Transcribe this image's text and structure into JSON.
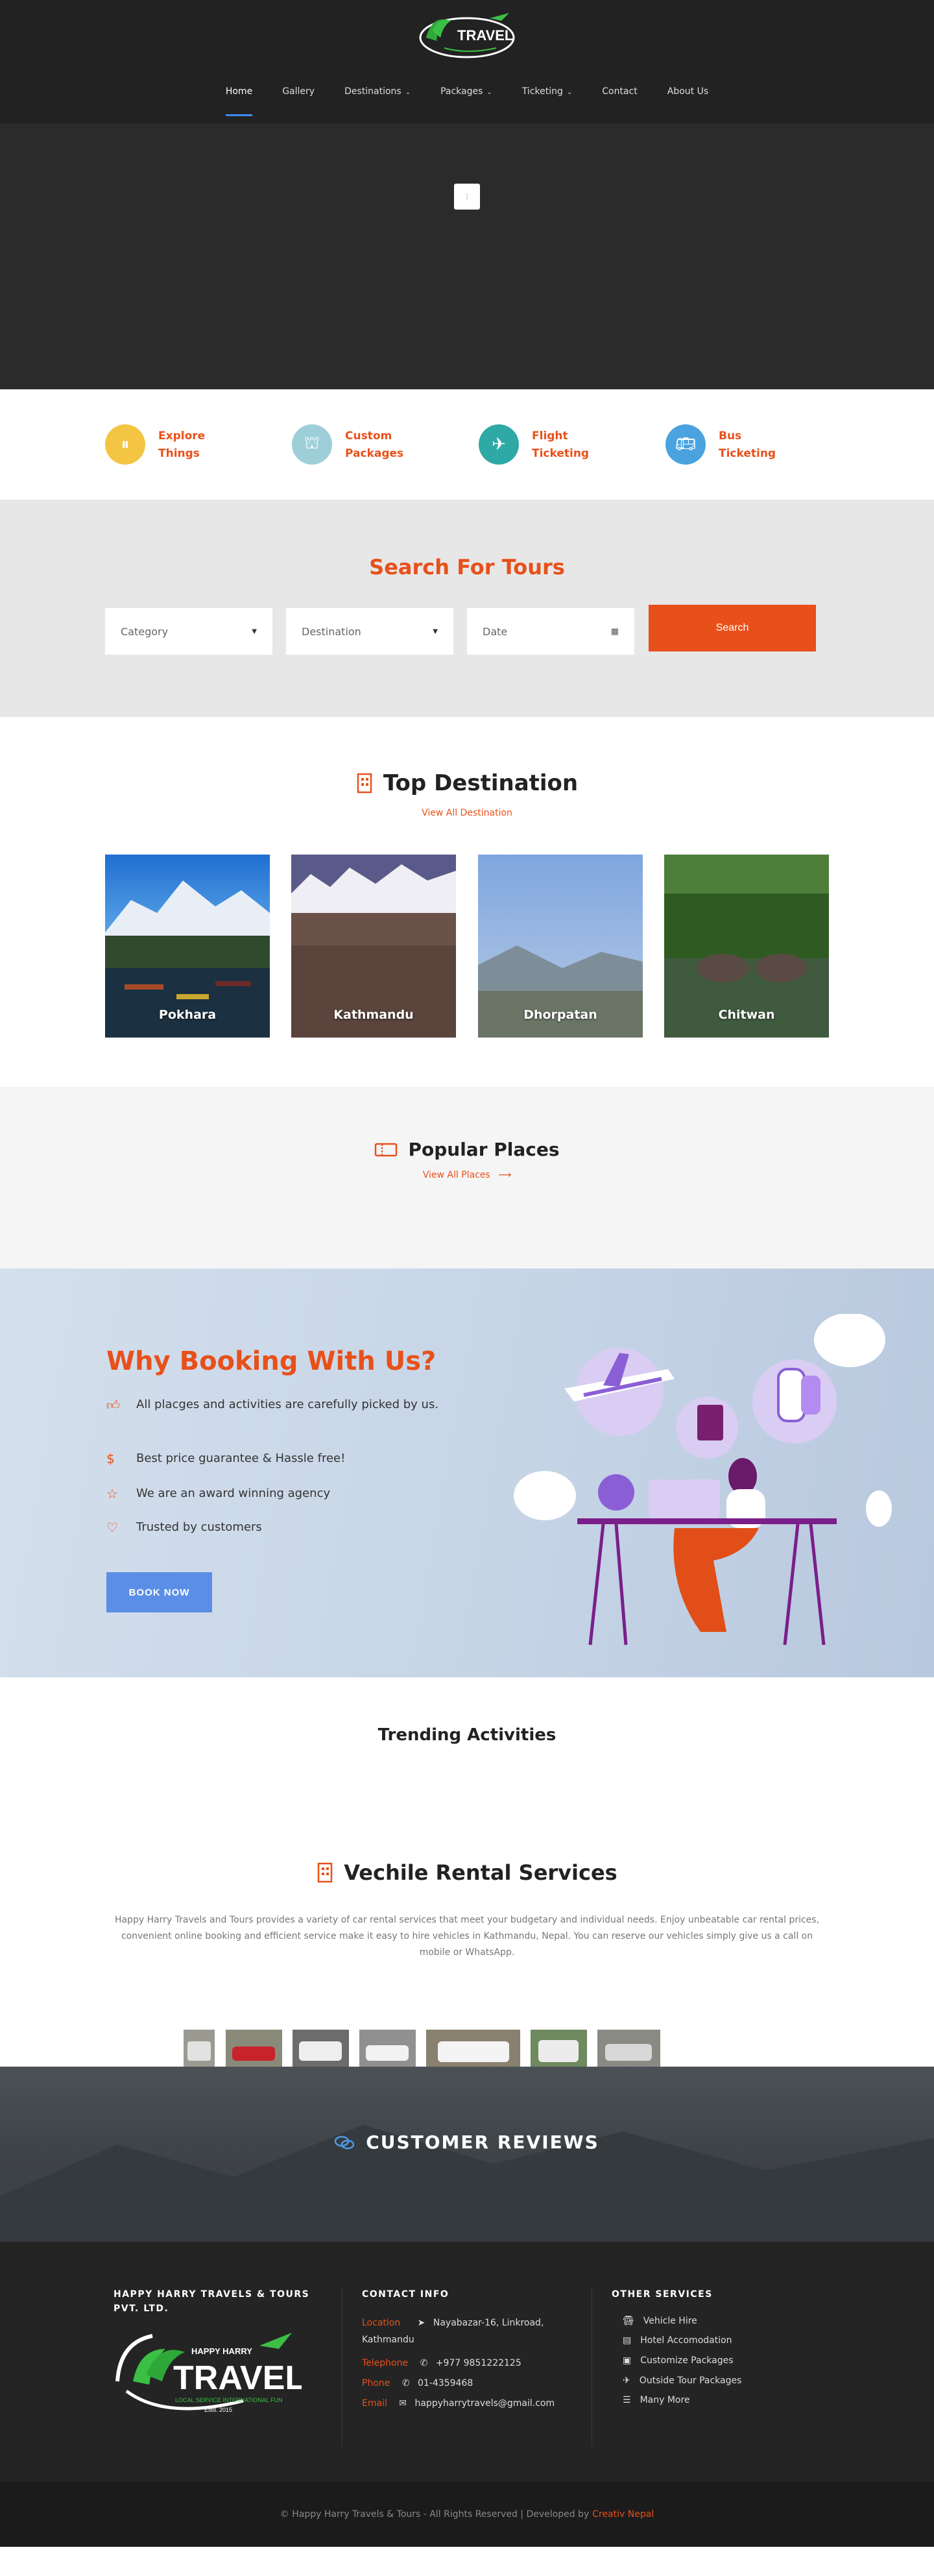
{
  "header": {
    "logo_text": "TRAVEL",
    "nav": [
      {
        "label": "Home",
        "caret": false
      },
      {
        "label": "Gallery",
        "caret": false
      },
      {
        "label": "Destinations",
        "caret": true
      },
      {
        "label": "Packages",
        "caret": true
      },
      {
        "label": "Ticketing",
        "caret": true
      },
      {
        "label": "Contact",
        "caret": false
      },
      {
        "label": "About Us",
        "caret": false
      }
    ]
  },
  "hero": {
    "loader": "⋮"
  },
  "features": [
    {
      "label": "Explore Things",
      "icon": "pause-circle-icon",
      "color": "#f4c543"
    },
    {
      "label": "Custom Packages",
      "icon": "eiffel-tower-icon",
      "color": "#9ecfd9"
    },
    {
      "label": "Flight Ticketing",
      "icon": "airplane-icon",
      "color": "#2ea9a5"
    },
    {
      "label": "Bus Ticketing",
      "icon": "bus-icon",
      "color": "#4aa3df"
    }
  ],
  "search": {
    "title": "Search For Tours",
    "category": "Category",
    "destination": "Destination",
    "date": "Date",
    "button": "Search"
  },
  "top_destination": {
    "title": "Top Destination",
    "link": "View All Destination",
    "cards": [
      {
        "name": "Pokhara"
      },
      {
        "name": "Kathmandu"
      },
      {
        "name": "Dhorpatan"
      },
      {
        "name": "Chitwan"
      }
    ]
  },
  "popular": {
    "title": "Popular Places",
    "link": "View All Places",
    "arrow": "⟶"
  },
  "why": {
    "title": "Why Booking With Us?",
    "items": [
      "All placges and activities are carefully picked by us.",
      "Best price guarantee & Hassle free!",
      "We are an award winning agency",
      "Trusted by customers"
    ],
    "button": "BOOK NOW"
  },
  "trending": {
    "title": "Trending Activities"
  },
  "vehicle": {
    "title": "Vechile Rental Services",
    "description": "Happy Harry Travels and Tours provides a variety of car rental services that meet your budgetary and individual needs. Enjoy unbeatable car rental prices, convenient online booking and efficient service make it easy to hire vehicles in Kathmandu, Nepal. You can reserve our vehicles simply give us a call on mobile or WhatsApp."
  },
  "reviews": {
    "title": "CUSTOMER REVIEWS"
  },
  "footer": {
    "company": "HAPPY HARRY TRAVELS & TOURS PVT. LTD.",
    "contact_title": "CONTACT INFO",
    "location_label": "Location",
    "location": "Nayabazar-16, Linkroad, Kathmandu",
    "telephone_label": "Telephone",
    "telephone": "+977 9851222125",
    "phone_label": "Phone",
    "phone": "01-4359468",
    "email_label": "Email",
    "email": "happyharrytravels@gmail.com",
    "services_title": "OTHER SERVICES",
    "services": [
      "Vehicle Hire",
      "Hotel Accomodation",
      "Customize Packages",
      "Outside Tour Packages",
      "Many More"
    ],
    "logo_top": "HAPPY HARRY",
    "logo_main": "TRAVEL",
    "logo_sub": "LOCAL SERVICE INTERNATIONAL FUN",
    "logo_estd": "Estd. 2015"
  },
  "bottom": {
    "copyright": "© Happy Harry Travels & Tours - All Rights Reserved | Developed by",
    "developer": "Creativ Nepal"
  }
}
